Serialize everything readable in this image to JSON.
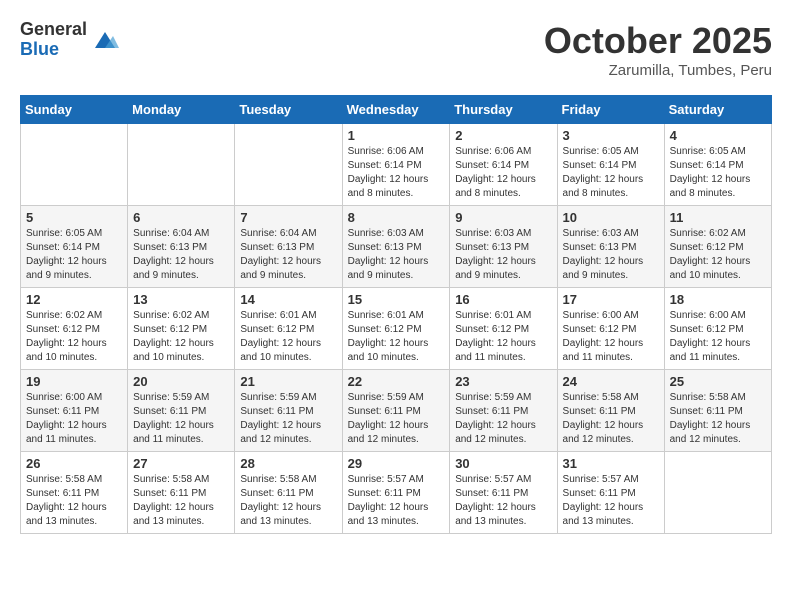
{
  "header": {
    "logo_general": "General",
    "logo_blue": "Blue",
    "month_title": "October 2025",
    "location": "Zarumilla, Tumbes, Peru"
  },
  "days_of_week": [
    "Sunday",
    "Monday",
    "Tuesday",
    "Wednesday",
    "Thursday",
    "Friday",
    "Saturday"
  ],
  "weeks": [
    [
      {
        "day": "",
        "info": ""
      },
      {
        "day": "",
        "info": ""
      },
      {
        "day": "",
        "info": ""
      },
      {
        "day": "1",
        "info": "Sunrise: 6:06 AM\nSunset: 6:14 PM\nDaylight: 12 hours and 8 minutes."
      },
      {
        "day": "2",
        "info": "Sunrise: 6:06 AM\nSunset: 6:14 PM\nDaylight: 12 hours and 8 minutes."
      },
      {
        "day": "3",
        "info": "Sunrise: 6:05 AM\nSunset: 6:14 PM\nDaylight: 12 hours and 8 minutes."
      },
      {
        "day": "4",
        "info": "Sunrise: 6:05 AM\nSunset: 6:14 PM\nDaylight: 12 hours and 8 minutes."
      }
    ],
    [
      {
        "day": "5",
        "info": "Sunrise: 6:05 AM\nSunset: 6:14 PM\nDaylight: 12 hours and 9 minutes."
      },
      {
        "day": "6",
        "info": "Sunrise: 6:04 AM\nSunset: 6:13 PM\nDaylight: 12 hours and 9 minutes."
      },
      {
        "day": "7",
        "info": "Sunrise: 6:04 AM\nSunset: 6:13 PM\nDaylight: 12 hours and 9 minutes."
      },
      {
        "day": "8",
        "info": "Sunrise: 6:03 AM\nSunset: 6:13 PM\nDaylight: 12 hours and 9 minutes."
      },
      {
        "day": "9",
        "info": "Sunrise: 6:03 AM\nSunset: 6:13 PM\nDaylight: 12 hours and 9 minutes."
      },
      {
        "day": "10",
        "info": "Sunrise: 6:03 AM\nSunset: 6:13 PM\nDaylight: 12 hours and 9 minutes."
      },
      {
        "day": "11",
        "info": "Sunrise: 6:02 AM\nSunset: 6:12 PM\nDaylight: 12 hours and 10 minutes."
      }
    ],
    [
      {
        "day": "12",
        "info": "Sunrise: 6:02 AM\nSunset: 6:12 PM\nDaylight: 12 hours and 10 minutes."
      },
      {
        "day": "13",
        "info": "Sunrise: 6:02 AM\nSunset: 6:12 PM\nDaylight: 12 hours and 10 minutes."
      },
      {
        "day": "14",
        "info": "Sunrise: 6:01 AM\nSunset: 6:12 PM\nDaylight: 12 hours and 10 minutes."
      },
      {
        "day": "15",
        "info": "Sunrise: 6:01 AM\nSunset: 6:12 PM\nDaylight: 12 hours and 10 minutes."
      },
      {
        "day": "16",
        "info": "Sunrise: 6:01 AM\nSunset: 6:12 PM\nDaylight: 12 hours and 11 minutes."
      },
      {
        "day": "17",
        "info": "Sunrise: 6:00 AM\nSunset: 6:12 PM\nDaylight: 12 hours and 11 minutes."
      },
      {
        "day": "18",
        "info": "Sunrise: 6:00 AM\nSunset: 6:12 PM\nDaylight: 12 hours and 11 minutes."
      }
    ],
    [
      {
        "day": "19",
        "info": "Sunrise: 6:00 AM\nSunset: 6:11 PM\nDaylight: 12 hours and 11 minutes."
      },
      {
        "day": "20",
        "info": "Sunrise: 5:59 AM\nSunset: 6:11 PM\nDaylight: 12 hours and 11 minutes."
      },
      {
        "day": "21",
        "info": "Sunrise: 5:59 AM\nSunset: 6:11 PM\nDaylight: 12 hours and 12 minutes."
      },
      {
        "day": "22",
        "info": "Sunrise: 5:59 AM\nSunset: 6:11 PM\nDaylight: 12 hours and 12 minutes."
      },
      {
        "day": "23",
        "info": "Sunrise: 5:59 AM\nSunset: 6:11 PM\nDaylight: 12 hours and 12 minutes."
      },
      {
        "day": "24",
        "info": "Sunrise: 5:58 AM\nSunset: 6:11 PM\nDaylight: 12 hours and 12 minutes."
      },
      {
        "day": "25",
        "info": "Sunrise: 5:58 AM\nSunset: 6:11 PM\nDaylight: 12 hours and 12 minutes."
      }
    ],
    [
      {
        "day": "26",
        "info": "Sunrise: 5:58 AM\nSunset: 6:11 PM\nDaylight: 12 hours and 13 minutes."
      },
      {
        "day": "27",
        "info": "Sunrise: 5:58 AM\nSunset: 6:11 PM\nDaylight: 12 hours and 13 minutes."
      },
      {
        "day": "28",
        "info": "Sunrise: 5:58 AM\nSunset: 6:11 PM\nDaylight: 12 hours and 13 minutes."
      },
      {
        "day": "29",
        "info": "Sunrise: 5:57 AM\nSunset: 6:11 PM\nDaylight: 12 hours and 13 minutes."
      },
      {
        "day": "30",
        "info": "Sunrise: 5:57 AM\nSunset: 6:11 PM\nDaylight: 12 hours and 13 minutes."
      },
      {
        "day": "31",
        "info": "Sunrise: 5:57 AM\nSunset: 6:11 PM\nDaylight: 12 hours and 13 minutes."
      },
      {
        "day": "",
        "info": ""
      }
    ]
  ]
}
